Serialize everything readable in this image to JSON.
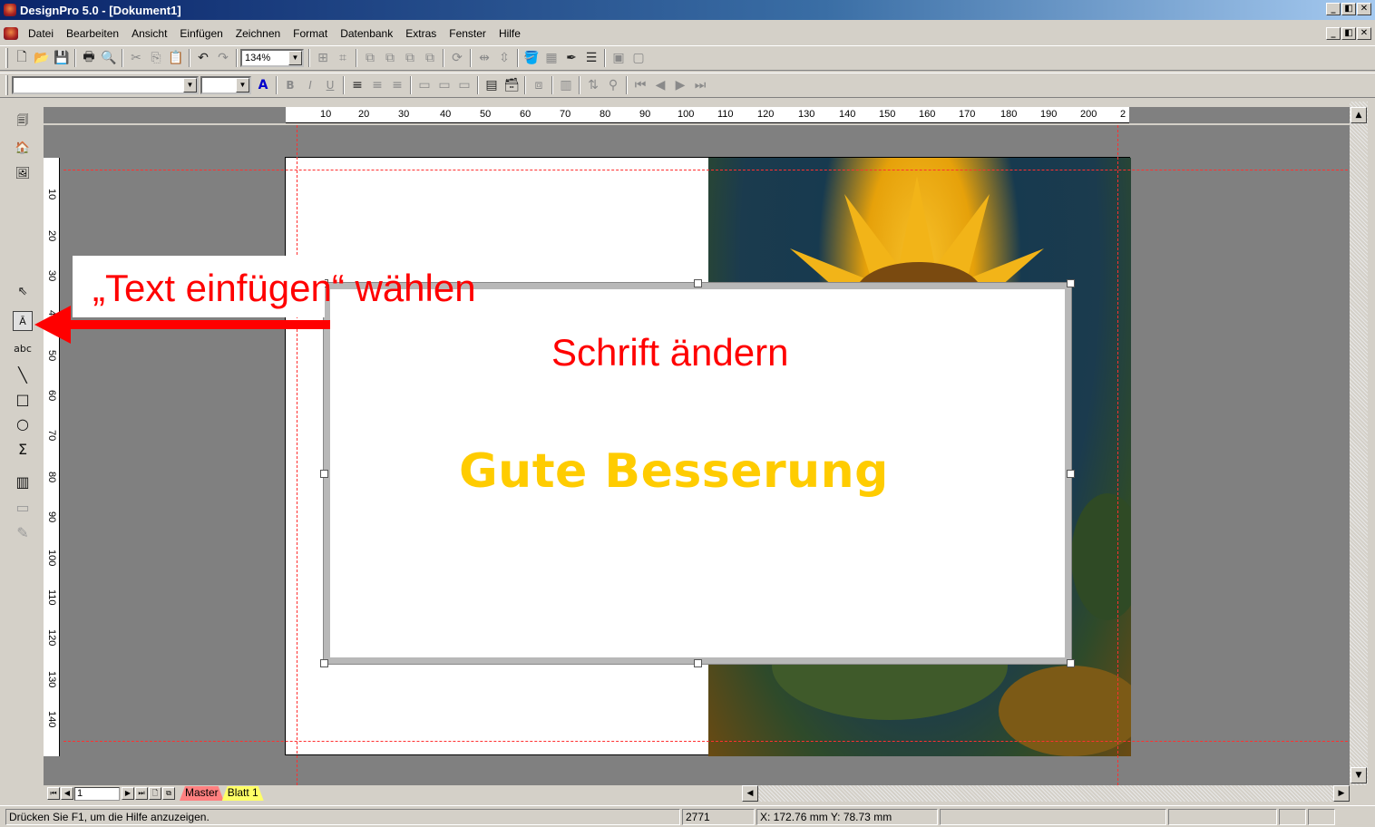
{
  "window": {
    "title": "DesignPro 5.0 - [Dokument1]",
    "minimize": "_",
    "restore": "◧",
    "close": "✕"
  },
  "menubar": {
    "items": [
      "Datei",
      "Bearbeiten",
      "Ansicht",
      "Einfügen",
      "Zeichnen",
      "Format",
      "Datenbank",
      "Extras",
      "Fenster",
      "Hilfe"
    ]
  },
  "toolbar": {
    "zoom_value": "134%",
    "font_name_value": "",
    "font_size_value": "",
    "text_color_label": "A",
    "bold_label": "B",
    "italic_label": "I",
    "underline_label": "U"
  },
  "rulers": {
    "horizontal_ticks": [
      "10",
      "20",
      "30",
      "40",
      "50",
      "60",
      "70",
      "80",
      "90",
      "100",
      "110",
      "120",
      "130",
      "140",
      "150",
      "160",
      "170",
      "180",
      "190",
      "200",
      "2"
    ],
    "vertical_ticks": [
      "10",
      "20",
      "30",
      "40",
      "50",
      "60",
      "70",
      "80",
      "90",
      "100",
      "110",
      "120",
      "130",
      "140"
    ]
  },
  "page_tabs": {
    "page_number": "1",
    "tabs": [
      "Master",
      "Blatt 1"
    ],
    "colors": {
      "master": "#ff8080",
      "sheet": "#ffff66"
    }
  },
  "annotations": {
    "insert_text_callout": "„Text einfügen“ wählen",
    "change_font": "Schrift ändern",
    "callout_color": "#ff0000"
  },
  "canvas": {
    "greeting_text": "Gute Besserung",
    "greeting_color": "#ffcc00"
  },
  "statusbar": {
    "help_text": "Drücken Sie F1, um die Hilfe anzuzeigen.",
    "value": "2771",
    "coordinates": "X: 172.76 mm  Y: 78.73 mm"
  },
  "icons": {
    "pointer": "pointer-icon",
    "insert_text": "insert-text-icon",
    "curved_text": "curved-text-icon",
    "line": "line-icon",
    "rectangle": "rectangle-icon",
    "ellipse": "ellipse-icon",
    "polygon": "polygon-icon",
    "barcode": "barcode-icon"
  }
}
